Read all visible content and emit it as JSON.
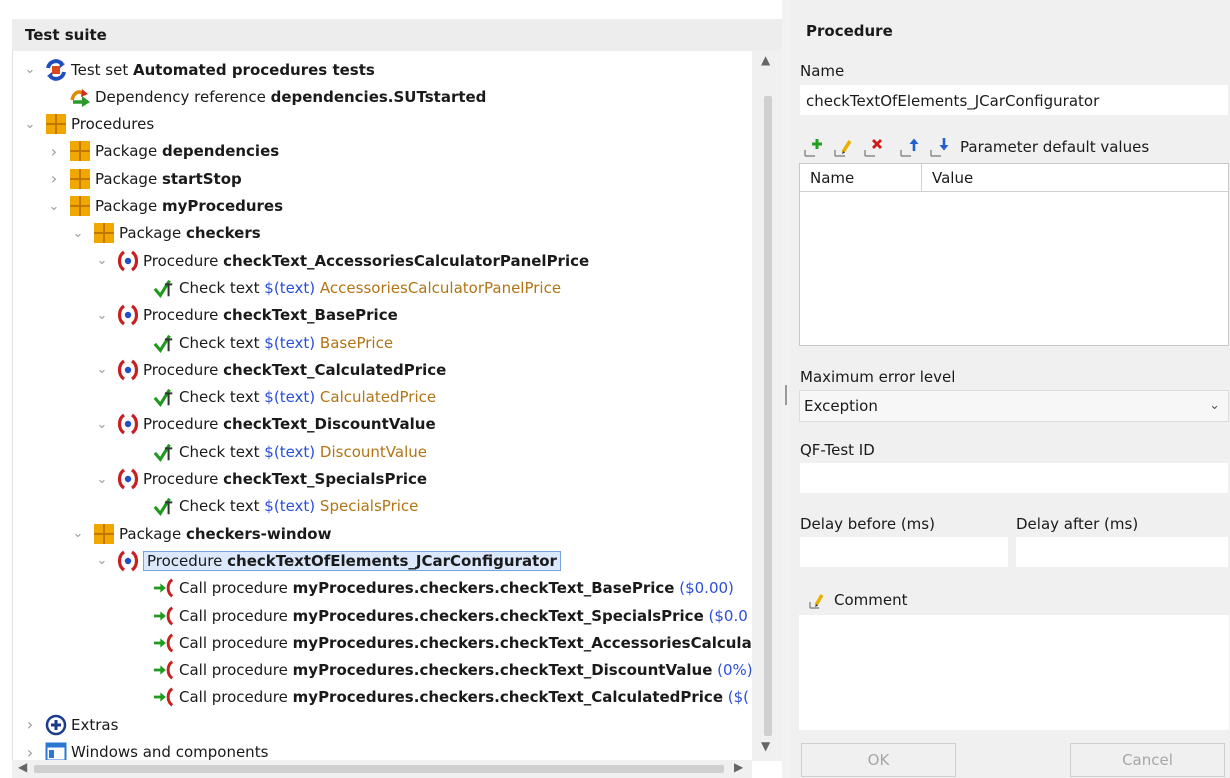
{
  "left_panel": {
    "title": "Test suite",
    "tree": [
      {
        "level": 0,
        "expander": "expanded",
        "icon": "test-set-icon",
        "parts": [
          {
            "t": "Test set ",
            "s": "plain"
          },
          {
            "t": "Automated procedures tests",
            "s": "bold"
          }
        ]
      },
      {
        "level": 1,
        "expander": "none",
        "icon": "dependency-reference-icon",
        "parts": [
          {
            "t": "Dependency reference ",
            "s": "plain"
          },
          {
            "t": "dependencies.SUTstarted",
            "s": "bold"
          }
        ]
      },
      {
        "level": 0,
        "expander": "expanded",
        "icon": "procedures-folder-icon",
        "parts": [
          {
            "t": "Procedures",
            "s": "plain"
          }
        ]
      },
      {
        "level": 1,
        "expander": "collapsed",
        "icon": "package-icon",
        "parts": [
          {
            "t": "Package ",
            "s": "plain"
          },
          {
            "t": "dependencies",
            "s": "bold"
          }
        ]
      },
      {
        "level": 1,
        "expander": "collapsed",
        "icon": "package-icon",
        "parts": [
          {
            "t": "Package ",
            "s": "plain"
          },
          {
            "t": "startStop",
            "s": "bold"
          }
        ]
      },
      {
        "level": 1,
        "expander": "expanded",
        "icon": "package-icon",
        "parts": [
          {
            "t": "Package ",
            "s": "plain"
          },
          {
            "t": "myProcedures",
            "s": "bold"
          }
        ]
      },
      {
        "level": 2,
        "expander": "expanded",
        "icon": "package-icon",
        "parts": [
          {
            "t": "Package ",
            "s": "plain"
          },
          {
            "t": "checkers",
            "s": "bold"
          }
        ]
      },
      {
        "level": 3,
        "expander": "expanded",
        "icon": "procedure-icon",
        "parts": [
          {
            "t": "Procedure ",
            "s": "plain"
          },
          {
            "t": "checkText_AccessoriesCalculatorPanelPrice",
            "s": "bold"
          }
        ]
      },
      {
        "level": 4,
        "expander": "none",
        "icon": "check-text-icon",
        "parts": [
          {
            "t": "Check text ",
            "s": "plain"
          },
          {
            "t": "$(text)",
            "s": "blue"
          },
          {
            "t": " AccessoriesCalculatorPanelPrice",
            "s": "brown"
          }
        ]
      },
      {
        "level": 3,
        "expander": "expanded",
        "icon": "procedure-icon",
        "parts": [
          {
            "t": "Procedure ",
            "s": "plain"
          },
          {
            "t": "checkText_BasePrice",
            "s": "bold"
          }
        ]
      },
      {
        "level": 4,
        "expander": "none",
        "icon": "check-text-icon",
        "parts": [
          {
            "t": "Check text ",
            "s": "plain"
          },
          {
            "t": "$(text)",
            "s": "blue"
          },
          {
            "t": " BasePrice",
            "s": "brown"
          }
        ]
      },
      {
        "level": 3,
        "expander": "expanded",
        "icon": "procedure-icon",
        "parts": [
          {
            "t": "Procedure ",
            "s": "plain"
          },
          {
            "t": "checkText_CalculatedPrice",
            "s": "bold"
          }
        ]
      },
      {
        "level": 4,
        "expander": "none",
        "icon": "check-text-icon",
        "parts": [
          {
            "t": "Check text ",
            "s": "plain"
          },
          {
            "t": "$(text)",
            "s": "blue"
          },
          {
            "t": " CalculatedPrice",
            "s": "brown"
          }
        ]
      },
      {
        "level": 3,
        "expander": "expanded",
        "icon": "procedure-icon",
        "parts": [
          {
            "t": "Procedure ",
            "s": "plain"
          },
          {
            "t": "checkText_DiscountValue",
            "s": "bold"
          }
        ]
      },
      {
        "level": 4,
        "expander": "none",
        "icon": "check-text-icon",
        "parts": [
          {
            "t": "Check text ",
            "s": "plain"
          },
          {
            "t": "$(text)",
            "s": "blue"
          },
          {
            "t": " DiscountValue",
            "s": "brown"
          }
        ]
      },
      {
        "level": 3,
        "expander": "expanded",
        "icon": "procedure-icon",
        "parts": [
          {
            "t": "Procedure ",
            "s": "plain"
          },
          {
            "t": "checkText_SpecialsPrice",
            "s": "bold"
          }
        ]
      },
      {
        "level": 4,
        "expander": "none",
        "icon": "check-text-icon",
        "parts": [
          {
            "t": "Check text ",
            "s": "plain"
          },
          {
            "t": "$(text)",
            "s": "blue"
          },
          {
            "t": " SpecialsPrice",
            "s": "brown"
          }
        ]
      },
      {
        "level": 2,
        "expander": "expanded",
        "icon": "package-icon",
        "parts": [
          {
            "t": "Package ",
            "s": "plain"
          },
          {
            "t": "checkers-window",
            "s": "bold"
          }
        ]
      },
      {
        "level": 3,
        "expander": "expanded",
        "icon": "procedure-icon",
        "selected": true,
        "parts": [
          {
            "t": "Procedure ",
            "s": "plain"
          },
          {
            "t": "checkTextOfElements_JCarConfigurator",
            "s": "bold"
          }
        ]
      },
      {
        "level": 4,
        "expander": "none",
        "icon": "call-procedure-icon",
        "parts": [
          {
            "t": "Call procedure ",
            "s": "plain"
          },
          {
            "t": "myProcedures.checkers.checkText_BasePrice",
            "s": "bold"
          },
          {
            "t": " ($0.00)",
            "s": "blue"
          }
        ]
      },
      {
        "level": 4,
        "expander": "none",
        "icon": "call-procedure-icon",
        "parts": [
          {
            "t": "Call procedure ",
            "s": "plain"
          },
          {
            "t": "myProcedures.checkers.checkText_SpecialsPrice",
            "s": "bold"
          },
          {
            "t": " ($0.0",
            "s": "blue"
          }
        ]
      },
      {
        "level": 4,
        "expander": "none",
        "icon": "call-procedure-icon",
        "parts": [
          {
            "t": "Call procedure ",
            "s": "plain"
          },
          {
            "t": "myProcedures.checkers.checkText_AccessoriesCalcula",
            "s": "bold"
          }
        ]
      },
      {
        "level": 4,
        "expander": "none",
        "icon": "call-procedure-icon",
        "parts": [
          {
            "t": "Call procedure ",
            "s": "plain"
          },
          {
            "t": "myProcedures.checkers.checkText_DiscountValue",
            "s": "bold"
          },
          {
            "t": " (0%)",
            "s": "blue"
          }
        ]
      },
      {
        "level": 4,
        "expander": "none",
        "icon": "call-procedure-icon",
        "parts": [
          {
            "t": "Call procedure ",
            "s": "plain"
          },
          {
            "t": "myProcedures.checkers.checkText_CalculatedPrice",
            "s": "bold"
          },
          {
            "t": " ($(",
            "s": "blue"
          }
        ]
      },
      {
        "level": 0,
        "expander": "collapsed",
        "icon": "extras-icon",
        "parts": [
          {
            "t": "Extras",
            "s": "plain"
          }
        ]
      },
      {
        "level": 0,
        "expander": "collapsed",
        "icon": "windows-components-icon",
        "parts": [
          {
            "t": "Windows and components",
            "s": "plain"
          }
        ]
      }
    ]
  },
  "right_panel": {
    "title": "Procedure",
    "name_label": "Name",
    "name_value": "checkTextOfElements_JCarConfigurator",
    "param_toolbar": {
      "add_icon": "add-icon",
      "edit_icon": "edit-icon",
      "delete_icon": "delete-icon",
      "move_up_icon": "move-up-icon",
      "move_down_icon": "move-down-icon",
      "label": "Parameter default values"
    },
    "param_table": {
      "col_name": "Name",
      "col_value": "Value",
      "rows": []
    },
    "max_error_label": "Maximum error level",
    "max_error_value": "Exception",
    "qf_id_label": "QF-Test ID",
    "qf_id_value": "",
    "delay_before_label": "Delay before (ms)",
    "delay_before_value": "",
    "delay_after_label": "Delay after (ms)",
    "delay_after_value": "",
    "comment_label": "Comment",
    "comment_value": "",
    "ok_label": "OK",
    "cancel_label": "Cancel"
  },
  "colors": {
    "header_bg": "#ededed",
    "panel_bg": "#f0f0f0",
    "bold_blue": "#2a4fd8",
    "brown": "#b27414",
    "selection_bg": "#dce8fb",
    "selection_border": "#7aa4d8"
  }
}
